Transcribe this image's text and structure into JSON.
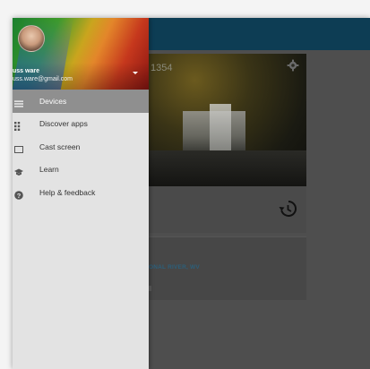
{
  "user": {
    "name": "uss ware",
    "email": "uss.ware@gmail.com"
  },
  "menu": {
    "items": [
      {
        "label": "Devices",
        "icon": "devices-icon",
        "active": true
      },
      {
        "label": "Discover apps",
        "icon": "apps-grid-icon",
        "active": false
      },
      {
        "label": "Cast screen",
        "icon": "cast-screen-icon",
        "active": false
      },
      {
        "label": "Learn",
        "icon": "learn-icon",
        "active": false
      },
      {
        "label": "Help & feedback",
        "icon": "help-icon",
        "active": false
      }
    ]
  },
  "card": {
    "photo_number": "1354",
    "title": "IONAL RIVER, WV"
  },
  "colors": {
    "app_bar": "#0d3d54",
    "drawer_bg": "#e3e3e3",
    "active_item_bg": "#8f8f8f",
    "card_title": "#2c5f7a"
  }
}
